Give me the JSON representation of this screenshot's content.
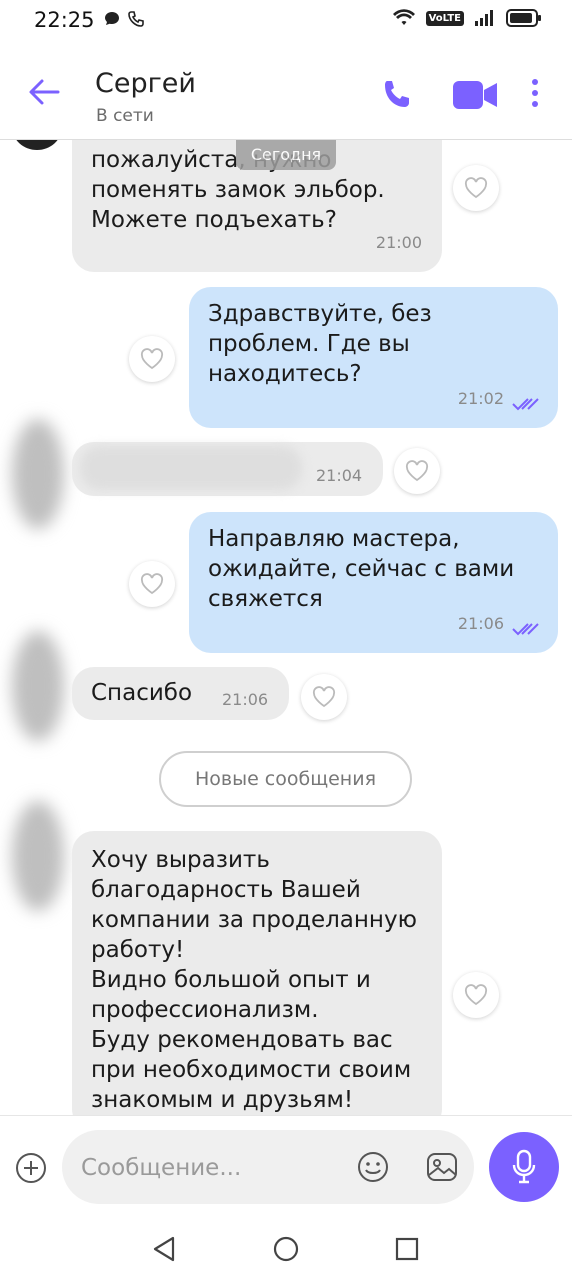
{
  "status_bar": {
    "time": "22:25",
    "volte": "VoLTE"
  },
  "header": {
    "contact_name": "Сергей",
    "presence": "В сети"
  },
  "date_chip": "Сегодня",
  "messages": [
    {
      "dir": "in",
      "text": "пожалуйста, нужно\nпоменять замок эльбор.\nМожете подъехать?",
      "time": "21:00"
    },
    {
      "dir": "out",
      "text": "Здравствуйте, без\nпроблем. Где вы\nнаходитесь?",
      "time": "21:02"
    },
    {
      "dir": "in",
      "text": "",
      "time": "21:04"
    },
    {
      "dir": "out",
      "text": "Направляю мастера,\nожидайте, сейчас с вами\nсвяжется",
      "time": "21:06"
    },
    {
      "dir": "in",
      "text": "Спасибо",
      "time": "21:06"
    },
    {
      "dir": "in",
      "text": "Хочу выразить\nблагодарность Вашей\nкомпании за проделанную\nработу!\nВидно большой опыт и\nпрофессионализм.\nБуду рекомендовать вас\nпри необходимости своим\nзнакомым и друзьям!",
      "time": ""
    }
  ],
  "new_messages_label": "Новые сообщения",
  "composer": {
    "placeholder": "Сообщение..."
  },
  "colors": {
    "accent": "#7b61ff",
    "outgoing": "#cde4fb",
    "incoming": "#ebebeb"
  },
  "icons": [
    "back-arrow-icon",
    "phone-icon",
    "video-icon",
    "more-icon",
    "heart-icon",
    "read-ticks-icon",
    "plus-icon",
    "emoji-icon",
    "gallery-icon",
    "mic-icon"
  ]
}
